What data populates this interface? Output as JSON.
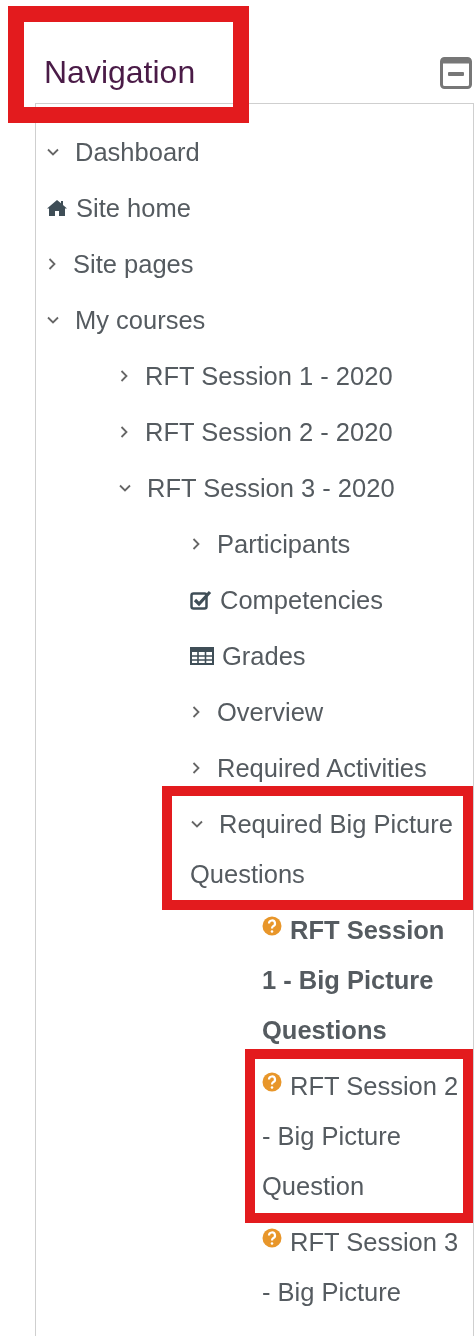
{
  "block": {
    "title": "Navigation",
    "title_highlighted": true
  },
  "items": [
    {
      "label": "Dashboard",
      "kind": "branch",
      "expanded": true,
      "active": false,
      "highlighted": false
    },
    {
      "label": "Site home",
      "kind": "home",
      "active": false,
      "highlighted": false
    },
    {
      "label": "Site pages",
      "kind": "branch",
      "expanded": false,
      "active": false,
      "highlighted": false
    },
    {
      "label": "My courses",
      "kind": "branch",
      "expanded": true,
      "active": false,
      "highlighted": false,
      "children": [
        {
          "label": "RFT Session 1 - 2020",
          "kind": "branch",
          "expanded": false,
          "active": false,
          "highlighted": false
        },
        {
          "label": "RFT Session 2 - 2020",
          "kind": "branch",
          "expanded": false,
          "active": false,
          "highlighted": false
        },
        {
          "label": "RFT Session 3 - 2020",
          "kind": "branch",
          "expanded": true,
          "active": false,
          "highlighted": false,
          "children": [
            {
              "label": "Participants",
              "kind": "branch",
              "expanded": false,
              "active": false,
              "highlighted": false
            },
            {
              "label": "Competencies",
              "kind": "checklist",
              "active": false,
              "highlighted": false
            },
            {
              "label": "Grades",
              "kind": "grid",
              "active": false,
              "highlighted": false
            },
            {
              "label": "Overview",
              "kind": "branch",
              "expanded": false,
              "active": false,
              "highlighted": false
            },
            {
              "label": "Required Activities",
              "kind": "branch",
              "expanded": false,
              "active": false,
              "highlighted": false
            },
            {
              "label": "Required Big Picture Questions",
              "kind": "branch",
              "expanded": true,
              "active": false,
              "highlighted": true,
              "children": [
                {
                  "label": "RFT Session 1 - Big Picture Questions",
                  "kind": "quiz",
                  "active": true,
                  "highlighted": false
                },
                {
                  "label": "RFT Session 2 - Big Picture Question",
                  "kind": "quiz",
                  "active": false,
                  "highlighted": true
                },
                {
                  "label": "RFT Session 3 - Big Picture",
                  "kind": "quiz",
                  "active": false,
                  "highlighted": false
                }
              ]
            }
          ]
        }
      ]
    }
  ]
}
